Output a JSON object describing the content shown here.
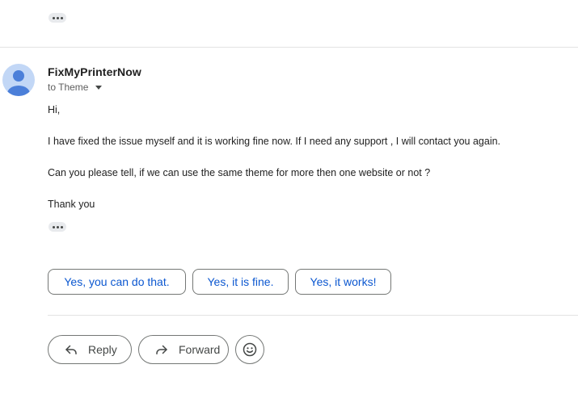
{
  "previous_message": {
    "expand_label": "Show trimmed content"
  },
  "message": {
    "sender": "FixMyPrinterNow",
    "recipient": "to Theme",
    "body": [
      "Hi,",
      "I have fixed the issue myself and it is working fine now. If I need any support , I will contact you again.",
      "Can you please tell, if we can use the same theme for more then one website or not ?",
      "Thank you"
    ]
  },
  "smart_replies": [
    "Yes, you can do that.",
    "Yes, it is fine.",
    "Yes, it works!"
  ],
  "actions": {
    "reply_label": "Reply",
    "forward_label": "Forward"
  },
  "colors": {
    "accent": "#0b57d0",
    "avatar_bg": "#c2d7f6",
    "avatar_fg": "#4b7fd9"
  },
  "icons": {
    "avatar": "person-icon",
    "reply": "reply-arrow-icon",
    "forward": "forward-arrow-icon",
    "emoji": "smiley-icon",
    "more": "more-horiz-icon"
  }
}
